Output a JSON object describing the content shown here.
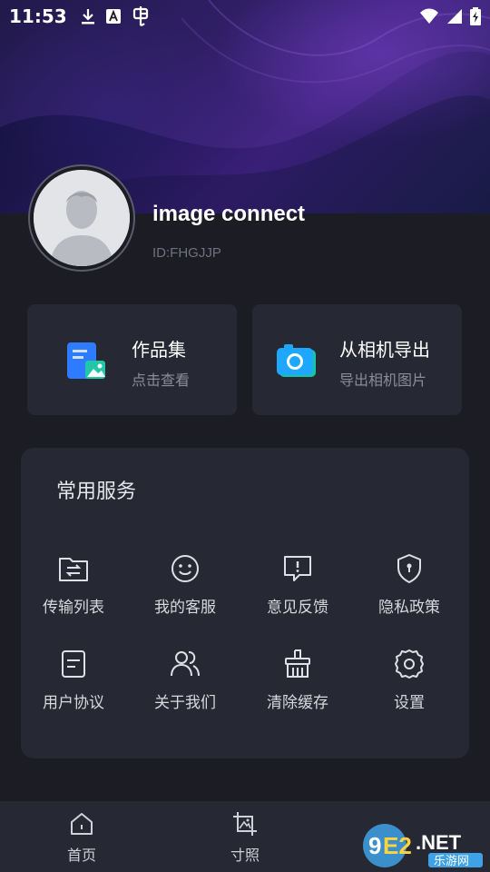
{
  "status": {
    "time": "11:53"
  },
  "profile": {
    "name": "image connect",
    "id": "ID:FHGJJP"
  },
  "cards": [
    {
      "title": "作品集",
      "subtitle": "点击查看",
      "icon": "gallery-icon",
      "color": "#2f7bff"
    },
    {
      "title": "从相机导出",
      "subtitle": "导出相机图片",
      "icon": "camera-icon",
      "color": "#1ea7ff"
    }
  ],
  "services": {
    "heading": "常用服务",
    "items": [
      {
        "label": "传输列表",
        "icon": "folder-transfer-icon"
      },
      {
        "label": "我的客服",
        "icon": "smiley-icon"
      },
      {
        "label": "意见反馈",
        "icon": "feedback-icon"
      },
      {
        "label": "隐私政策",
        "icon": "shield-lock-icon"
      },
      {
        "label": "用户协议",
        "icon": "document-icon"
      },
      {
        "label": "关于我们",
        "icon": "users-icon"
      },
      {
        "label": "清除缓存",
        "icon": "broom-icon"
      },
      {
        "label": "设置",
        "icon": "gear-icon"
      }
    ]
  },
  "nav": [
    {
      "label": "首页",
      "icon": "home-icon"
    },
    {
      "label": "寸照",
      "icon": "photo-crop-icon"
    }
  ],
  "watermark": {
    "brand": "9E2.NET",
    "site": "乐游网"
  }
}
